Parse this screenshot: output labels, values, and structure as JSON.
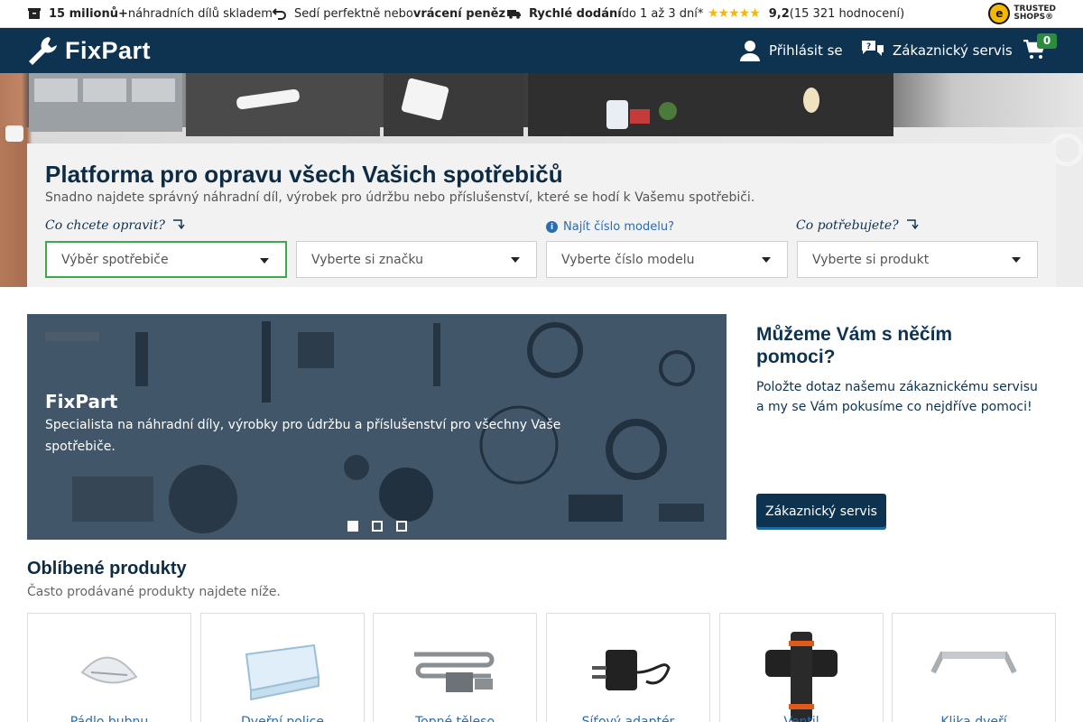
{
  "usp_bar": {
    "stock_bold": "15 milionů+",
    "stock_text": " náhradních dílů skladem",
    "return_text": "Sedí perfektně nebo ",
    "return_bold": "vrácení peněz",
    "delivery_bold": "Rychlé dodání",
    "delivery_text": " do 1 až 3 dní*",
    "stars": "★★★★★",
    "rating_bold": "9,2",
    "rating_text": " (15 321 hodnocení)",
    "trusted_line1": "TRUSTED",
    "trusted_line2": "SHOPS®"
  },
  "header": {
    "logo": "FixPart",
    "login_label": "Přihlásit se",
    "service_label": "Zákaznický servis",
    "cart_count": "0",
    "brand_color": "#0d3350"
  },
  "search": {
    "title": "Platforma pro opravu všech Vašich spotřebičů",
    "subtitle": "Snadno najdete správný náhradní díl, výrobek pro údržbu nebo příslušenství, které se hodí k Vašemu spotřebiči.",
    "hint_repair": "Co chcete opravit?",
    "hint_model": "Najít číslo modelu?",
    "hint_need": "Co potřebujete?",
    "appliance_placeholder": "Výběr spotřebiče",
    "brand_placeholder": "Vyberte si značku",
    "model_placeholder": "Vyberte číslo modelu",
    "product_placeholder": "Vyberte si produkt"
  },
  "banner": {
    "title": "FixPart",
    "text": "Specialista na náhradní díly, výrobky pro údržbu a příslušenství pro všechny Vaše spotřebiče.",
    "active_slide": 1,
    "slide_count": 3
  },
  "help": {
    "title": "Můžeme Vám s něčím pomoci?",
    "text": "Položte dotaz našemu zákaznickému servisu a my se Vám pokusíme co nejdříve pomoci!",
    "button_label": "Zákaznický servis"
  },
  "popular": {
    "title": "Oblíbené produkty",
    "subtitle": "Často prodávané produkty najdete níže.",
    "items": [
      {
        "name": "Pádlo bubnu",
        "icon": "drum-paddle-icon"
      },
      {
        "name": "Dveřní police",
        "icon": "door-shelf-icon"
      },
      {
        "name": "Topné těleso",
        "icon": "heating-element-icon"
      },
      {
        "name": "Síťový adaptér",
        "icon": "power-adapter-icon"
      },
      {
        "name": "Ventil",
        "icon": "valve-icon"
      },
      {
        "name": "Klika dveří",
        "icon": "door-handle-icon"
      }
    ]
  }
}
